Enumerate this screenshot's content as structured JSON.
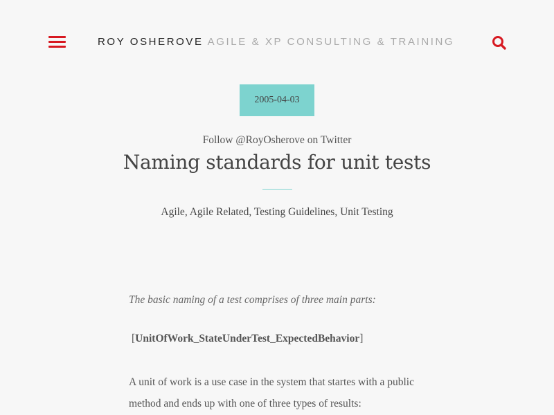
{
  "header": {
    "brand_name": "ROY OSHEROVE",
    "brand_tagline": "AGILE & XP CONSULTING & TRAINING",
    "menu_icon": "hamburger-menu-icon",
    "search_icon": "search-icon",
    "accent_color": "#d71921"
  },
  "post": {
    "date": "2005-04-03",
    "follow_text": "Follow @RoyOsherove on Twitter",
    "title": "Naming standards for unit tests",
    "categories": [
      "Agile",
      "Agile Related",
      "Testing Guidelines",
      "Unit Testing"
    ],
    "badge_color": "#7dd3cf"
  },
  "body": {
    "intro": "The basic naming of a test comprises of three main parts:",
    "pattern_open": "[",
    "pattern": "UnitOfWork_StateUnderTest_ExpectedBehavior",
    "pattern_close": "]",
    "paragraph": "A unit of work is a use case in the system that startes with a public method and ends up with one of three types of results:"
  }
}
